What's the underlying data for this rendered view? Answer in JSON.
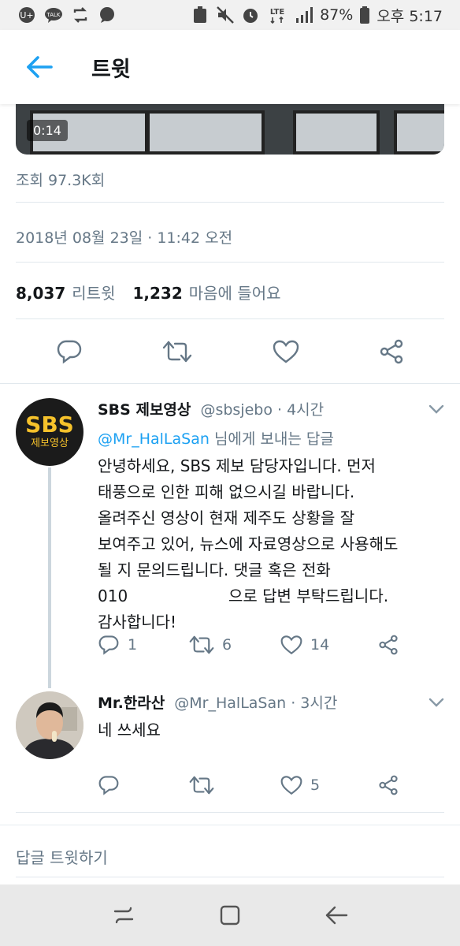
{
  "status_bar": {
    "battery": "87%",
    "time": "오후 5:17",
    "network": "LTE",
    "notification_icons": [
      "u-plus-icon",
      "talk-icon",
      "sync-icon",
      "chat-icon"
    ],
    "system_icons": [
      "recycle-icon",
      "mute-icon",
      "alarm-icon",
      "lte-icon",
      "signal-icon",
      "battery-icon"
    ]
  },
  "app_bar": {
    "title": "트윗"
  },
  "video": {
    "duration": "0:14"
  },
  "stats": {
    "views": "조회 97.3K회",
    "timestamp": "2018년 08월 23일 · 11:42 오전",
    "retweet_count": "8,037",
    "retweet_label": "리트윗",
    "like_count": "1,232",
    "like_label": "마음에 들어요"
  },
  "replies": [
    {
      "name": "SBS 제보영상",
      "handle": "@sbsjebo",
      "time": "· 4시간",
      "avatar_text_top": "SBS",
      "avatar_text_bottom": "제보영상",
      "reply_mention": "@Mr_HalLaSan",
      "reply_suffix": "님에게 보내는 답글",
      "text_lines": [
        "안녕하세요, SBS 제보 담당자입니다. 먼저",
        "태풍으로 인한 피해 없으시길 바랍니다.",
        "올려주신 영상이 현재 제주도 상황을 잘",
        "보여주고 있어, 뉴스에 자료영상으로 사용해도",
        "될 지 문의드립니다. 댓글 혹은 전화",
        "010",
        "으로 답변 부탁드립니다.",
        "감사합니다!"
      ],
      "reply_count": "1",
      "retweet_count": "6",
      "like_count": "14"
    },
    {
      "name": "Mr.한라산",
      "handle": "@Mr_HalLaSan",
      "time": "· 3시간",
      "text": "네 쓰세요",
      "reply_count": "",
      "retweet_count": "",
      "like_count": "5"
    }
  ],
  "reply_box": {
    "placeholder": "답글 트윗하기"
  },
  "colors": {
    "accent": "#1da1f2",
    "secondary_text": "#657786",
    "sbs_yellow": "#f6c22b"
  }
}
